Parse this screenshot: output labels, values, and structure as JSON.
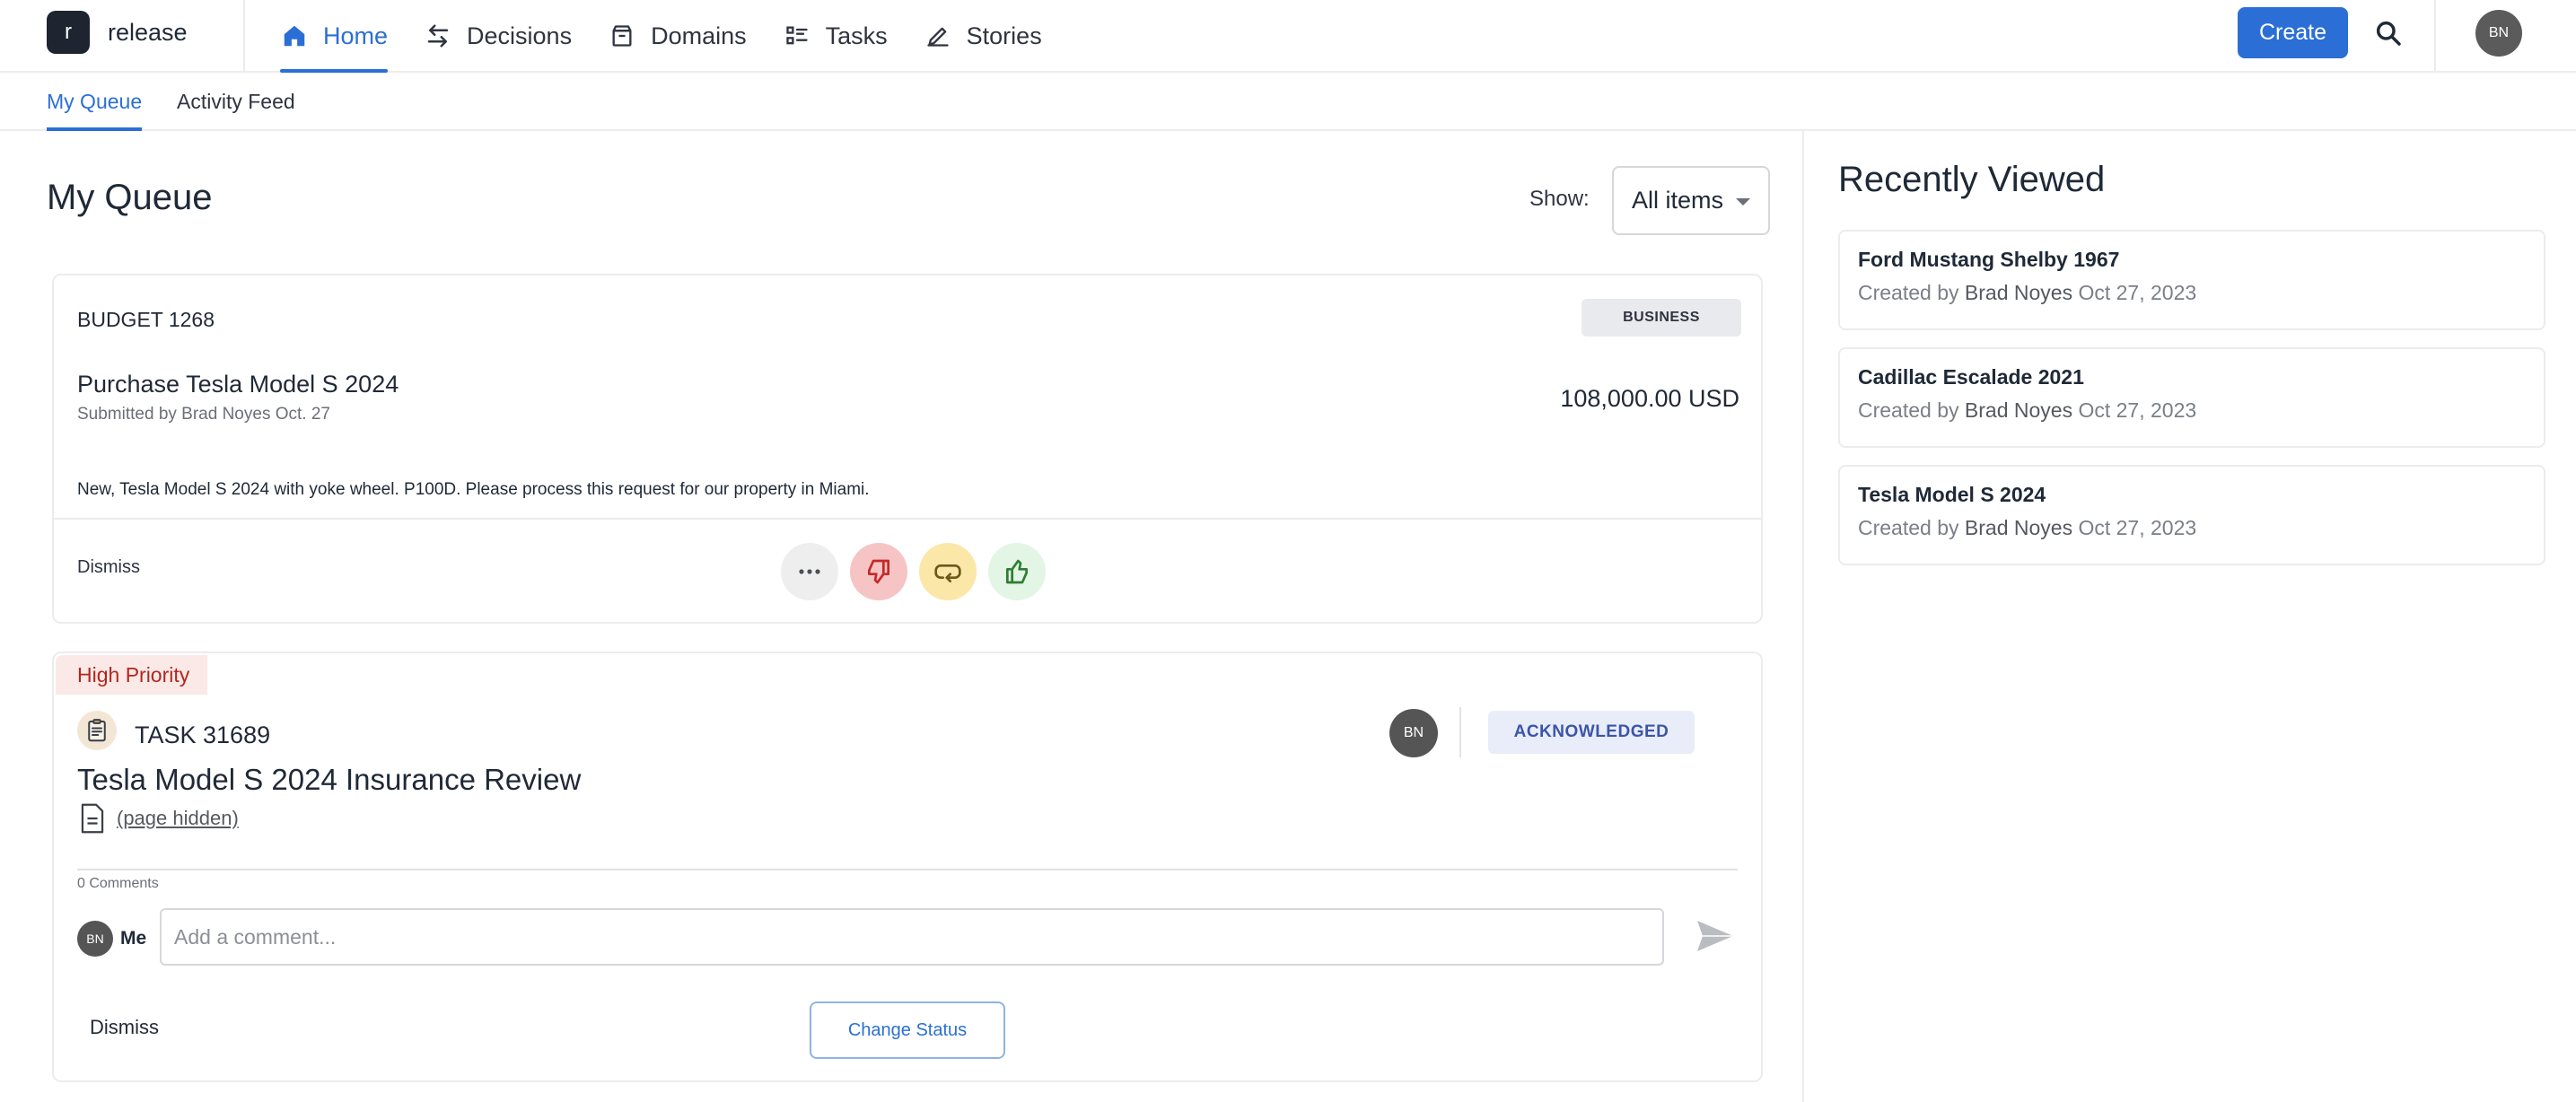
{
  "app": {
    "logo_letter": "r",
    "name": "release"
  },
  "nav": {
    "items": [
      {
        "label": "Home",
        "icon": "home-icon",
        "active": true
      },
      {
        "label": "Decisions",
        "icon": "arrows-exchange-icon"
      },
      {
        "label": "Domains",
        "icon": "archive-box-icon"
      },
      {
        "label": "Tasks",
        "icon": "task-list-icon"
      },
      {
        "label": "Stories",
        "icon": "pencil-icon"
      }
    ],
    "create_label": "Create",
    "search_icon": "search-icon",
    "user_initials": "BN"
  },
  "subtabs": [
    {
      "label": "My Queue",
      "active": true
    },
    {
      "label": "Activity Feed"
    }
  ],
  "queue": {
    "title": "My Queue",
    "show_label": "Show:",
    "show_value": "All items"
  },
  "budget_card": {
    "id": "BUDGET 1268",
    "category": "BUSINESS",
    "title": "Purchase Tesla Model S 2024",
    "submitted": "Submitted by Brad Noyes Oct. 27",
    "amount": "108,000.00 USD",
    "description": "New, Tesla Model S 2024 with yoke wheel. P100D. Please process this request for our property in Miami.",
    "dismiss_label": "Dismiss"
  },
  "task_card": {
    "priority": "High Priority",
    "id": "TASK 31689",
    "title": "Tesla Model S 2024 Insurance Review",
    "page_link": "(page hidden)",
    "assignee_initials": "BN",
    "status": "ACKNOWLEDGED",
    "comments_count": "0 Comments",
    "commenter_initials": "BN",
    "commenter_label": "Me",
    "comment_placeholder": "Add a comment...",
    "dismiss_label": "Dismiss",
    "change_status_label": "Change Status"
  },
  "recently_viewed": {
    "title": "Recently Viewed",
    "items": [
      {
        "title": "Ford Mustang Shelby 1967",
        "created_prefix": "Created by",
        "author": "Brad Noyes",
        "date": "Oct 27, 2023"
      },
      {
        "title": "Cadillac Escalade 2021",
        "created_prefix": "Created by",
        "author": "Brad Noyes",
        "date": "Oct 27, 2023"
      },
      {
        "title": "Tesla Model S 2024",
        "created_prefix": "Created by",
        "author": "Brad Noyes",
        "date": "Oct 27, 2023"
      }
    ]
  },
  "colors": {
    "accent": "#2b6fd6",
    "priority_text": "#b3261e",
    "status_text": "#3b55a8"
  }
}
